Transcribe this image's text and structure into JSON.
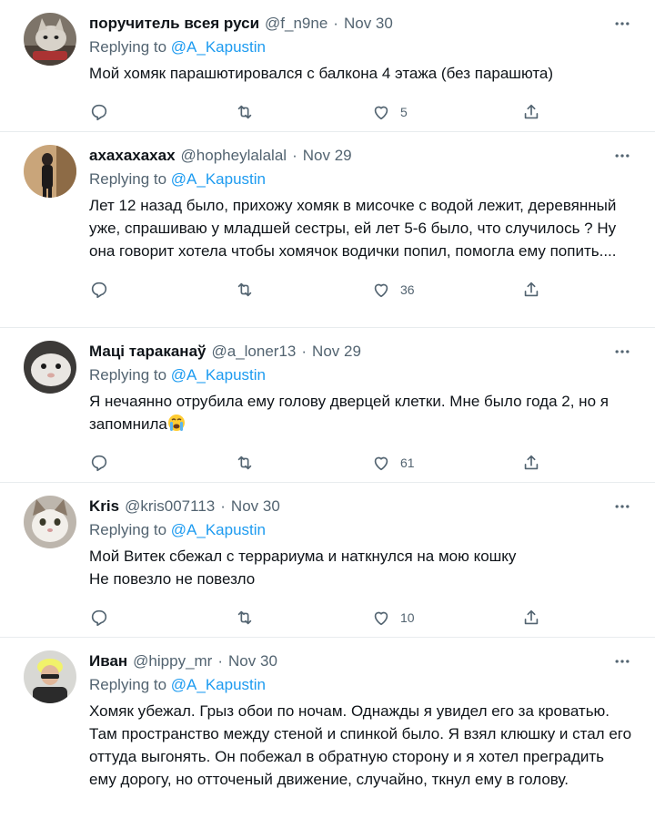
{
  "colors": {
    "accent": "#1d9bf0",
    "muted": "#536471",
    "text": "#0f1419",
    "divider": "#e8ecee"
  },
  "reply_prefix": "Replying to",
  "tweets": [
    {
      "name": "поручитель всея руси",
      "handle": "@f_n9ne",
      "date": "Nov 30",
      "mention": "@A_Kapustin",
      "text": "Мой хомяк парашютировался с балкона 4 этажа (без парашюта)",
      "likes": "5",
      "avatar_icon": "cat-avatar"
    },
    {
      "name": "ахахахахах",
      "handle": "@hopheylalalal",
      "date": "Nov 29",
      "mention": "@A_Kapustin",
      "text": "Лет 12 назад было, прихожу хомяк в мисочке с водой лежит, деревянный уже, спрашиваю у младшей сестры, ей лет 5-6 было, что случилось ? Ну она говорит хотела чтобы хомячок водички попил, помогла ему попить....",
      "likes": "36",
      "avatar_icon": "person-avatar"
    },
    {
      "name": "Маці тараканаў",
      "handle": "@a_loner13",
      "date": "Nov 29",
      "mention": "@A_Kapustin",
      "text": "Я нечаянно отрубила ему голову дверцей клетки. Мне было года 2, но я запомнила",
      "emoji": "crying-face-emoji",
      "likes": "61",
      "avatar_icon": "animal-avatar"
    },
    {
      "name": "Kris",
      "handle": "@kris007113",
      "date": "Nov 30",
      "mention": "@A_Kapustin",
      "text_lines": [
        "Мой Витек сбежал с террариума и наткнулся на мою кошку",
        "Не повезло не повезло"
      ],
      "likes": "10",
      "avatar_icon": "cat-avatar"
    },
    {
      "name": "Иван",
      "handle": "@hippy_mr",
      "date": "Nov 30",
      "mention": "@A_Kapustin",
      "text": "Хомяк убежал. Грыз обои по ночам. Однажды я увидел его за кроватью. Там пространство между стеной и спинкой было. Я взял клюшку и стал его оттуда выгонять. Он побежал в обратную сторону и я хотел преградить ему дорогу, но отточеный движение, случайно, ткнул ему в голову.",
      "avatar_icon": "person-avatar"
    }
  ]
}
